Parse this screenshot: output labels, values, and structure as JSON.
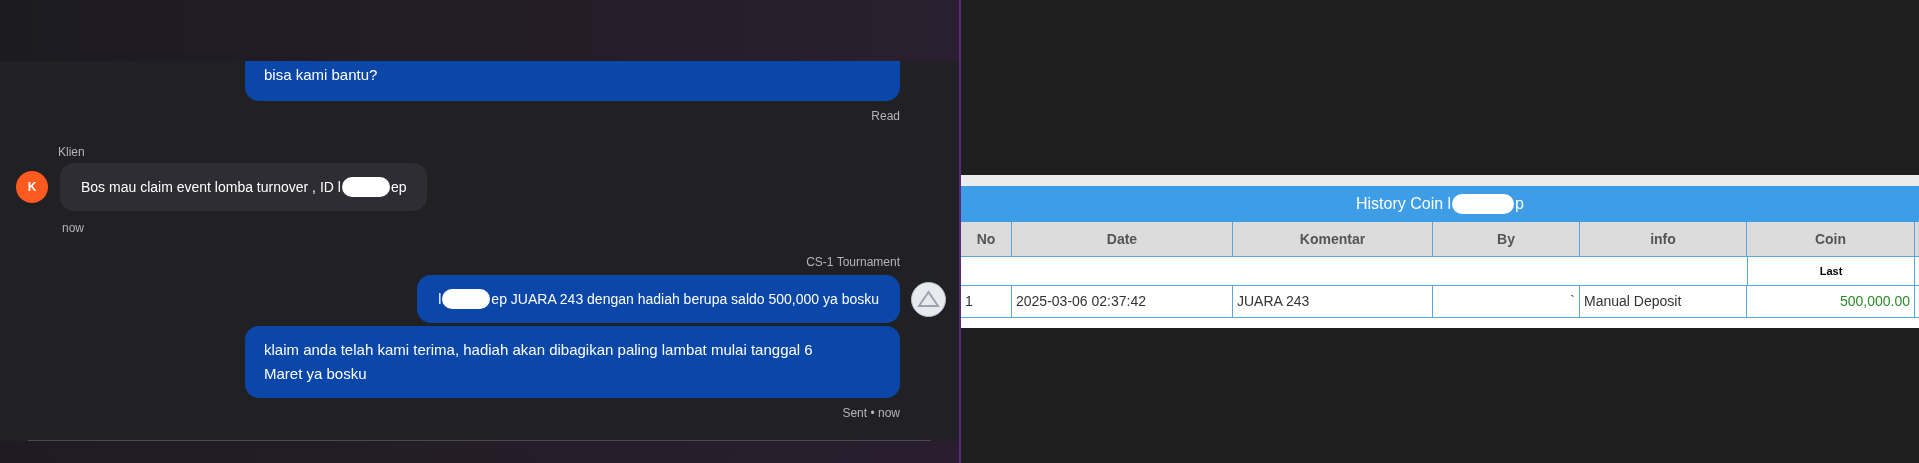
{
  "chat": {
    "messages": [
      {
        "kind": "outgoing",
        "text": "bisa kami bantu?",
        "status": "Read"
      },
      {
        "kind": "incoming",
        "sender": "Klien",
        "avatar": "K",
        "text_before": "Bos mau claim event lomba turnover , ID l",
        "redacted": true,
        "text_after": "ep",
        "time": "now"
      },
      {
        "kind": "outgoing",
        "sender": "CS-1 Tournament",
        "avatar_shown": true,
        "text_before": "l",
        "redacted": true,
        "text_after": "ep JUARA 243 dengan hadiah berupa saldo 500,000 ya bosku"
      },
      {
        "kind": "outgoing",
        "text": "klaim anda telah kami terima, hadiah akan dibagikan paling lambat mulai tanggal 6 Maret ya bosku",
        "status": "Sent • now"
      }
    ]
  },
  "history": {
    "title_before": "History Coin l",
    "title_redacted": true,
    "title_after": "p",
    "columns": [
      "No",
      "Date",
      "Komentar",
      "By",
      "info",
      "Coin"
    ],
    "coin_subheader": "Last",
    "rows": [
      {
        "cells": [
          "1",
          "2025-03-06 02:37:42",
          "JUARA 243",
          "`",
          "Manual Deposit",
          "500,000.00"
        ]
      }
    ]
  }
}
